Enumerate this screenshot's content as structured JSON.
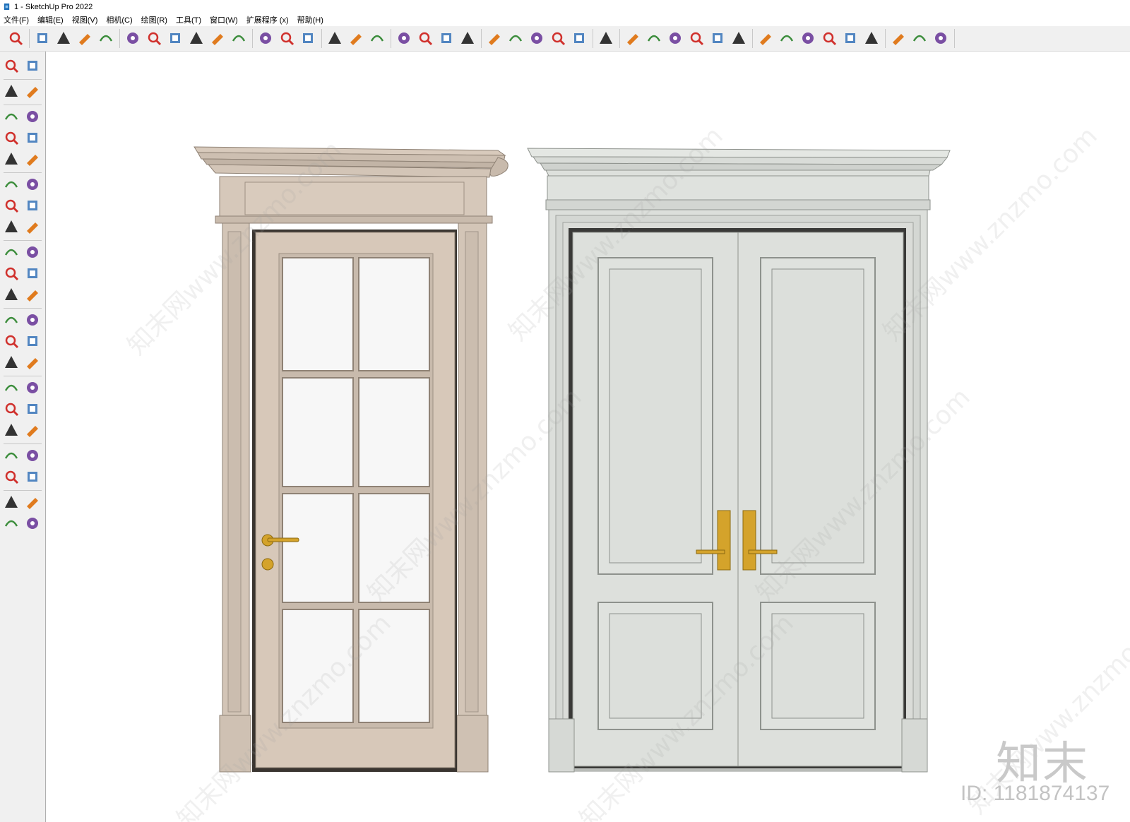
{
  "window": {
    "title": "1 - SketchUp Pro 2022"
  },
  "menu": {
    "items": [
      "文件(F)",
      "编辑(E)",
      "视图(V)",
      "相机(C)",
      "绘图(R)",
      "工具(T)",
      "窗口(W)",
      "扩展程序 (x)",
      "帮助(H)"
    ]
  },
  "toolbar": {
    "icons": [
      "zoom-icon",
      "select-icon",
      "eraser-icon",
      "pencil-icon",
      "arc-icon",
      "rectangle-icon",
      "push-pull-icon",
      "follow-me-icon",
      "move-icon",
      "rotate-icon",
      "scale-icon",
      "tape-measure-icon",
      "text-icon",
      "paint-bucket-icon",
      "orbit-icon",
      "pan-icon",
      "zoom-tool-icon",
      "zoom-extents-icon",
      "layers-icon",
      "sections-icon",
      "styles-icon",
      "tags-icon",
      "account-icon",
      "iso-view-icon",
      "front-view-icon",
      "home-icon",
      "back-view-icon",
      "right-view-icon",
      "left-view-icon",
      "component-icon",
      "xray-icon",
      "camera-icon",
      "plus-icon",
      "shield-icon",
      "materials-icon",
      "checker-icon",
      "upload-icon",
      "settings-icon",
      "comment-icon",
      "info-icon",
      "cart-icon",
      "user-icon"
    ]
  },
  "left_toolbar": {
    "icons": [
      "select-icon",
      "orbit-icon",
      "paint-bucket-icon",
      "eraser-icon",
      "component-icon",
      "tape-icon",
      "pencil-icon",
      "freehand-icon",
      "rectangle-icon",
      "rotated-rectangle-icon",
      "circle-icon",
      "polygon-icon",
      "arc-icon",
      "two-point-arc-icon",
      "three-point-arc-icon",
      "pie-icon",
      "move-icon",
      "push-pull-icon",
      "rotate-icon",
      "follow-me-icon",
      "scale-icon",
      "offset-icon",
      "tape-measure-icon",
      "dimension-icon",
      "protractor-icon",
      "text-icon",
      "axes-icon",
      "3d-text-icon",
      "orbit-tool-icon",
      "pan-icon",
      "zoom-icon",
      "zoom-window-icon",
      "zoom-extents-icon",
      "previous-view-icon",
      "position-camera-icon",
      "look-around-icon",
      "walk-icon",
      "section-plane-icon",
      "layers-icon",
      "sections-icon",
      "styles-icon",
      "tags-icon"
    ]
  },
  "viewport": {
    "watermark": "知末网www.znzmo.com",
    "brand": "知末",
    "image_id": "ID: 1181874137"
  },
  "colors": {
    "left_door": "#d6c7b8",
    "left_door_dark": "#b8a898",
    "right_door": "#dcdfdb",
    "right_door_dark": "#b6bab5",
    "handle": "#d4a32b",
    "glass": "#f7f7f7"
  }
}
